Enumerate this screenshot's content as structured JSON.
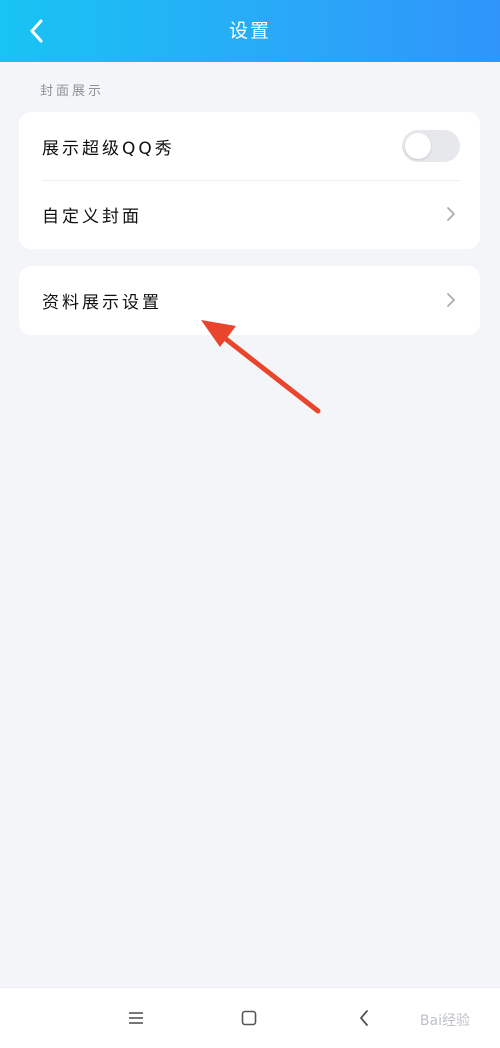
{
  "header": {
    "title": "设置",
    "back_icon": "chevron-left-icon",
    "gradient": [
      "#18c4f2",
      "#2f95fb"
    ]
  },
  "section": {
    "label": "封面展示"
  },
  "card1": {
    "rows": [
      {
        "label": "展示超级QQ秀",
        "control": "toggle",
        "toggle_on": false
      },
      {
        "label": "自定义封面",
        "control": "chevron-right-icon"
      }
    ]
  },
  "card2": {
    "rows": [
      {
        "label": "资料展示设置",
        "control": "chevron-right-icon"
      }
    ]
  },
  "annotation": {
    "type": "arrow",
    "color": "#e8452c"
  },
  "navbar": {
    "buttons": [
      "menu-icon",
      "home-square-icon",
      "back-triangle-icon"
    ]
  },
  "watermark": {
    "text": "Bai经验"
  },
  "colors": {
    "background": "#f4f5f9",
    "card": "#ffffff",
    "text": "#111111",
    "muted": "#8d939c"
  }
}
